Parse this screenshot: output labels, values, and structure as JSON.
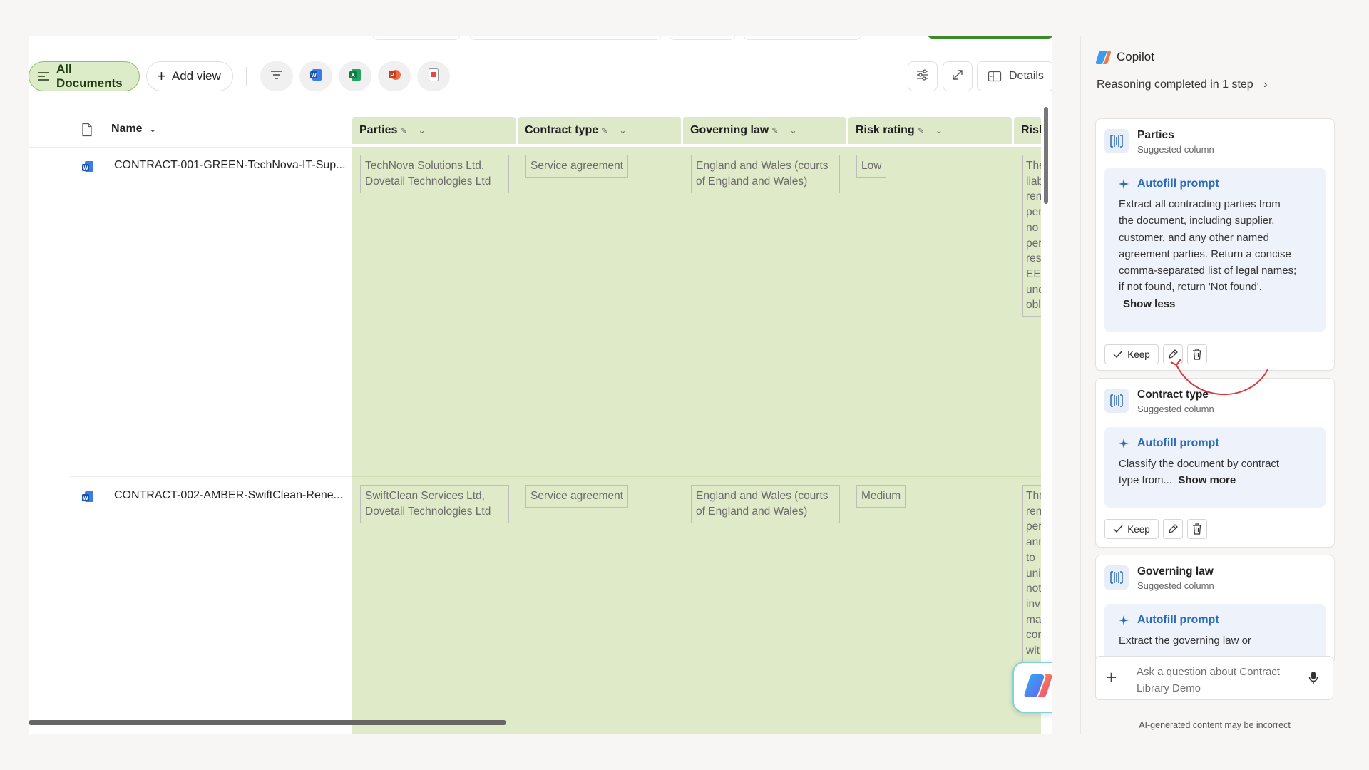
{
  "toolbar": {
    "all_documents": "All Documents",
    "add_view": "Add view",
    "details": "Details"
  },
  "columns": {
    "name": "Name",
    "parties": "Parties",
    "contract_type": "Contract type",
    "governing_law": "Governing law",
    "risk_rating": "Risk rating",
    "risk_trunc": "Risk"
  },
  "rows": [
    {
      "filename": "CONTRACT-001-GREEN-TechNova-IT-Sup...",
      "parties": [
        "TechNova Solutions Ltd,",
        "Dovetail Technologies Ltd"
      ],
      "contract_type": "Service agreement",
      "governing_law": [
        "England and Wales (courts",
        "of England and Wales)"
      ],
      "risk_rating": "Low",
      "risk_trunc": [
        "The",
        "liab",
        "ren",
        "per",
        "no",
        "per",
        "res",
        "EEA",
        "und",
        "obl"
      ]
    },
    {
      "filename": "CONTRACT-002-AMBER-SwiftClean-Rene...",
      "parties": [
        "SwiftClean Services Ltd,",
        "Dovetail Technologies Ltd"
      ],
      "contract_type": "Service agreement",
      "governing_law": [
        "England and Wales (courts",
        "of England and Wales)"
      ],
      "risk_rating": "Medium",
      "risk_trunc": [
        "The",
        "ren",
        "per",
        "ann",
        "to",
        "uni",
        "not",
        "inv",
        "ma",
        "cor",
        "wit"
      ]
    }
  ],
  "copilot": {
    "title": "Copilot",
    "reasoning": "Reasoning completed in 1 step",
    "cards": [
      {
        "title": "Parties",
        "subtitle": "Suggested column",
        "prompt_header": "Autofill prompt",
        "prompt_lines": [
          "Extract all contracting parties from",
          "the document, including supplier,",
          "customer, and any other named",
          "agreement parties. Return a concise",
          "comma-separated list of legal names;",
          "if not found, return 'Not found'."
        ],
        "toggle": "Show less",
        "keep": "Keep"
      },
      {
        "title": "Contract type",
        "subtitle": "Suggested column",
        "prompt_header": "Autofill prompt",
        "prompt_lines": [
          "Classify the document by contract",
          "type from..."
        ],
        "toggle": "Show more",
        "keep": "Keep"
      },
      {
        "title": "Governing law",
        "subtitle": "Suggested column",
        "prompt_header": "Autofill prompt",
        "prompt_lines": [
          "Extract the governing law or"
        ]
      }
    ],
    "ask_placeholder": "Ask a question about Contract Library Demo",
    "disclaimer": "AI-generated content may be incorrect"
  },
  "colors": {
    "column_green": "#dfeac9",
    "header_green": "#dde9c8",
    "accent_blue": "#2a6ab8",
    "annotation_red": "#d9363e"
  }
}
